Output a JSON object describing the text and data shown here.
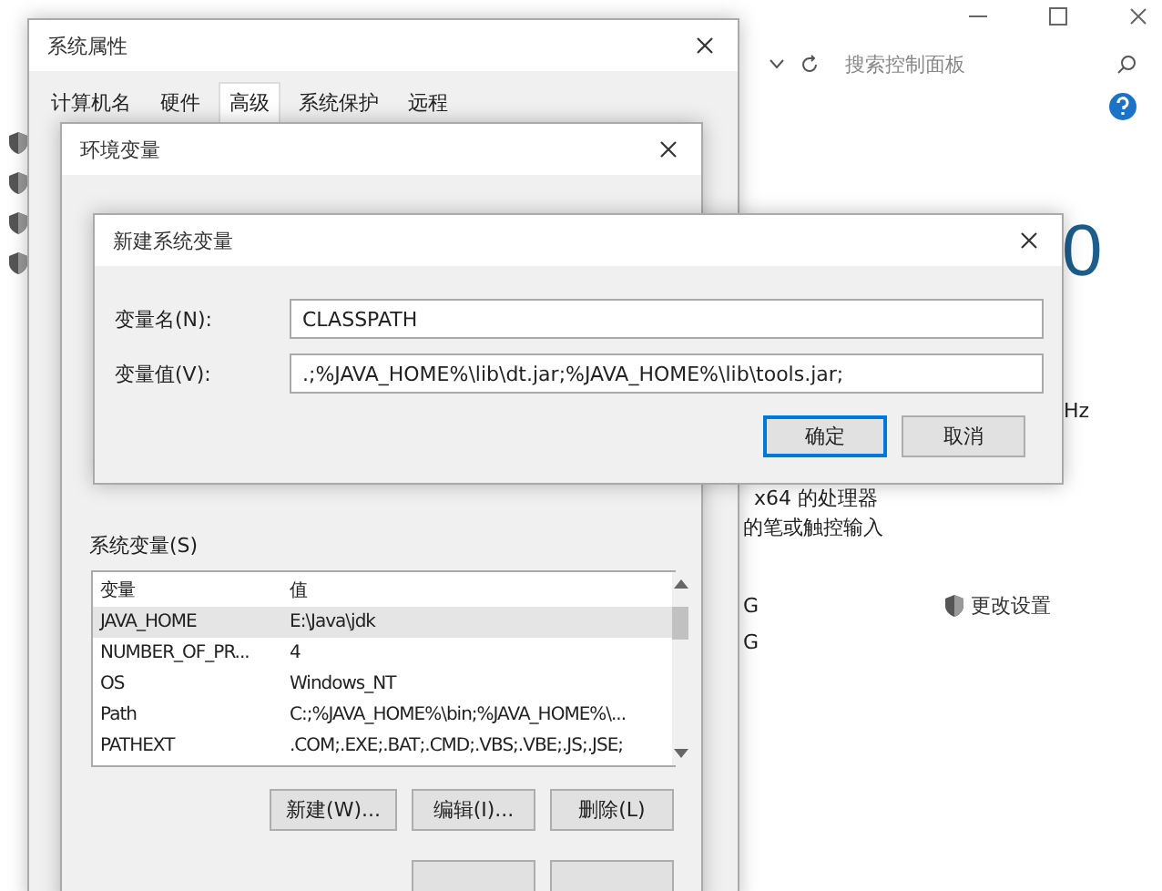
{
  "control_panel": {
    "search": {
      "placeholder": "搜索控制面板"
    },
    "big_text": "0",
    "texts": [
      "Hz",
      "x64 的处理器",
      "的笔或触控输入",
      "G",
      "G"
    ],
    "change_settings": "更改设置"
  },
  "system_properties": {
    "title": "系统属性",
    "tabs": [
      {
        "label": "计算机名",
        "selected": false
      },
      {
        "label": "硬件",
        "selected": false
      },
      {
        "label": "高级",
        "selected": true
      },
      {
        "label": "系统保护",
        "selected": false
      },
      {
        "label": "远程",
        "selected": false
      }
    ]
  },
  "environment_variables": {
    "title": "环境变量",
    "section_label": "系统变量(S)",
    "columns": [
      "变量",
      "值"
    ],
    "rows": [
      {
        "name": "JAVA_HOME",
        "value": "E:\\Java\\jdk",
        "selected": true
      },
      {
        "name": "NUMBER_OF_PR...",
        "value": "4",
        "selected": false
      },
      {
        "name": "OS",
        "value": "Windows_NT",
        "selected": false
      },
      {
        "name": "Path",
        "value": "C:;%JAVA_HOME%\\bin;%JAVA_HOME%\\...",
        "selected": false
      },
      {
        "name": "PATHEXT",
        "value": ".COM;.EXE;.BAT;.CMD;.VBS;.VBE;.JS;.JSE;",
        "selected": false
      }
    ],
    "buttons": [
      "新建(W)...",
      "编辑(I)...",
      "删除(L)"
    ]
  },
  "new_variable": {
    "title": "新建系统变量",
    "fields": [
      {
        "label": "变量名(N):",
        "value": "CLASSPATH"
      },
      {
        "label": "变量值(V):",
        "value": ".;%JAVA_HOME%\\lib\\dt.jar;%JAVA_HOME%\\lib\\tools.jar;"
      }
    ],
    "buttons": [
      {
        "label": "确定",
        "focused": true
      },
      {
        "label": "取消",
        "focused": false
      }
    ]
  }
}
